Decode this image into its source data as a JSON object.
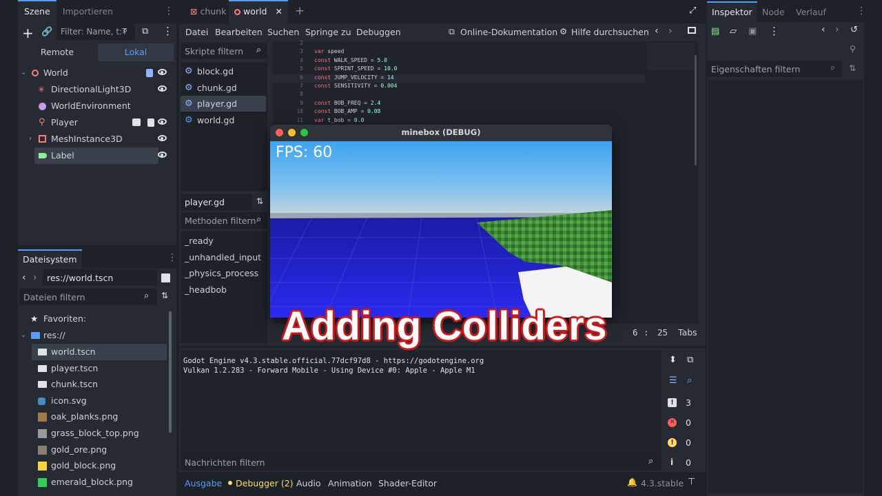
{
  "left_top": {
    "tabs": [
      "Szene",
      "Importieren"
    ],
    "filter_placeholder": "Filter: Name, t:T",
    "mode_tabs": [
      "Remote",
      "Lokal"
    ],
    "tree": [
      {
        "label": "World",
        "icon": "node3d-icon",
        "color": "#fc7f7f"
      },
      {
        "label": "DirectionalLight3D",
        "icon": "light-icon",
        "color": "#fc7f7f"
      },
      {
        "label": "WorldEnvironment",
        "icon": "globe-icon",
        "color": "#c89cf8"
      },
      {
        "label": "Player",
        "icon": "player-icon",
        "color": "#fc7f7f"
      },
      {
        "label": "MeshInstance3D",
        "icon": "mesh-icon",
        "color": "#fc7f7f"
      },
      {
        "label": "Label",
        "icon": "label-icon",
        "color": "#8eef97"
      }
    ]
  },
  "filesystem": {
    "tab": "Dateisystem",
    "path": "res://world.tscn",
    "filter_placeholder": "Dateien filtern",
    "favorites": "Favoriten:",
    "root": "res://",
    "files": [
      {
        "name": "world.tscn",
        "type": "scene"
      },
      {
        "name": "player.tscn",
        "type": "scene"
      },
      {
        "name": "chunk.tscn",
        "type": "scene"
      },
      {
        "name": "icon.svg",
        "type": "svg"
      },
      {
        "name": "oak_planks.png",
        "type": "png",
        "color": "#a07a47"
      },
      {
        "name": "grass_block_top.png",
        "type": "png",
        "color": "#9a9a9a"
      },
      {
        "name": "gold_ore.png",
        "type": "png",
        "color": "#8a8070"
      },
      {
        "name": "gold_block.png",
        "type": "png",
        "color": "#f5d33b"
      },
      {
        "name": "emerald_block.png",
        "type": "png",
        "color": "#2fcf55"
      }
    ]
  },
  "editor_tabs": [
    {
      "label": "chunk",
      "active": false
    },
    {
      "label": "world",
      "active": true
    }
  ],
  "menu": [
    "Datei",
    "Bearbeiten",
    "Suchen",
    "Springe zu",
    "Debuggen"
  ],
  "menu_right": {
    "docs": "Online-Dokumentation",
    "help": "Hilfe durchsuchen"
  },
  "scripts": {
    "filter_placeholder": "Skripte filtern",
    "list": [
      "block.gd",
      "chunk.gd",
      "player.gd",
      "world.gd"
    ],
    "selected": "player.gd",
    "current": "player.gd",
    "methods_placeholder": "Methoden filtern",
    "methods": [
      "_ready",
      "_unhandled_input",
      "_physics_process",
      "_headbob"
    ]
  },
  "code": [
    {
      "n": "2",
      "kw": "",
      "rest": ""
    },
    {
      "n": "3",
      "kw": "var",
      "rest": " speed"
    },
    {
      "n": "4",
      "kw": "const",
      "rest": " WALK_SPEED = ",
      "num": "5.0"
    },
    {
      "n": "5",
      "kw": "const",
      "rest": " SPRINT_SPEED = ",
      "num": "10.0"
    },
    {
      "n": "6",
      "kw": "const",
      "rest": " JUMP_VELOCITY = ",
      "num": "14"
    },
    {
      "n": "7",
      "kw": "const",
      "rest": " SENSITIVITY = ",
      "num": "0.004"
    },
    {
      "n": "8",
      "kw": "",
      "rest": ""
    },
    {
      "n": "9",
      "kw": "const",
      "rest": " BOB_FREQ = ",
      "num": "2.4"
    },
    {
      "n": "10",
      "kw": "const",
      "rest": " BOB_AMP = ",
      "num": "0.08"
    },
    {
      "n": "11",
      "kw": "var",
      "rest": " t_bob = ",
      "num": "0.0"
    }
  ],
  "status": {
    "line": "6",
    "sep": ":",
    "col": "25",
    "indent": "Tabs"
  },
  "output": {
    "lines": [
      "Godot Engine v4.3.stable.official.77dcf97d8 - https://godotengine.org",
      "Vulkan 1.2.283 - Forward Mobile - Using Device #0: Apple - Apple M1"
    ],
    "filter_placeholder": "Nachrichten filtern",
    "counts": {
      "messages": "3",
      "errors": "0",
      "warnings": "0",
      "info": "0"
    }
  },
  "bottom_tabs": [
    "Ausgabe",
    "Debugger (2)",
    "Audio",
    "Animation",
    "Shader-Editor"
  ],
  "version": "4.3.stable",
  "inspector": {
    "tabs": [
      "Inspektor",
      "Node",
      "Verlauf"
    ],
    "filter_placeholder": "Eigenschaften filtern"
  },
  "game_window": {
    "title": "minebox (DEBUG)",
    "fps": "FPS: 60"
  },
  "overlay_title": "Adding Colliders"
}
